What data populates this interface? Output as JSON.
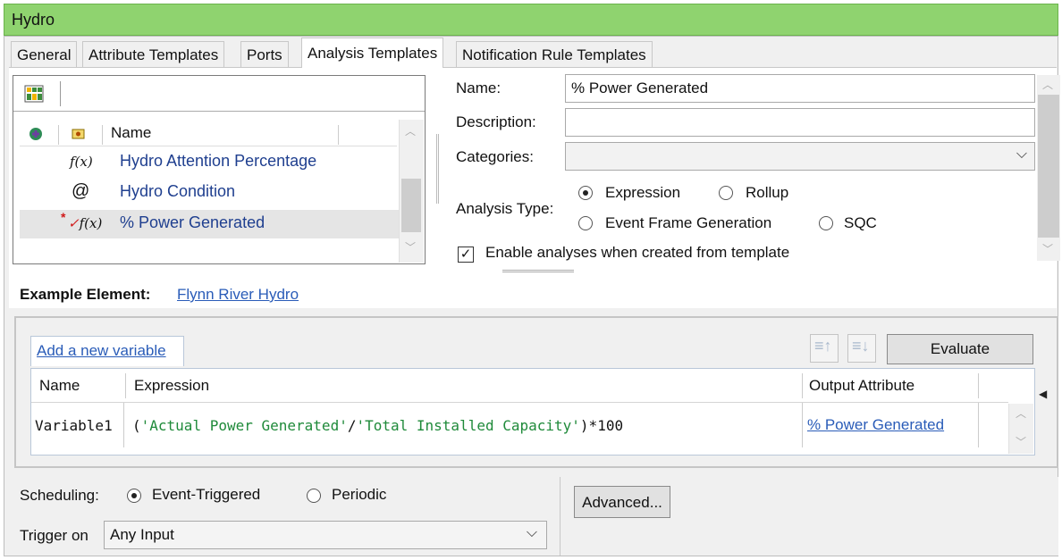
{
  "window": {
    "title": "Hydro"
  },
  "tabs": [
    {
      "label": "General"
    },
    {
      "label": "Attribute Templates"
    },
    {
      "label": "Ports"
    },
    {
      "label": "Analysis Templates"
    },
    {
      "label": "Notification Rule Templates"
    }
  ],
  "list": {
    "header_name": "Name",
    "items": [
      {
        "icon": "f(x)",
        "label": "Hydro Attention Percentage"
      },
      {
        "icon": "@",
        "label": "Hydro Condition"
      },
      {
        "icon": "f(x)",
        "label": "% Power Generated"
      }
    ]
  },
  "form": {
    "name_label": "Name:",
    "name_value": "% Power Generated",
    "description_label": "Description:",
    "description_value": "",
    "categories_label": "Categories:",
    "categories_value": "",
    "analysis_type_label": "Analysis Type:",
    "analysis_type_options": [
      "Expression",
      "Rollup",
      "Event Frame Generation",
      "SQC"
    ],
    "analysis_type_selected": "Expression",
    "enable_label": "Enable analyses when created from template",
    "enable_checked": true
  },
  "example_element": {
    "label": "Example Element:",
    "value": "Flynn River Hydro"
  },
  "variables": {
    "add_link": "Add a new variable",
    "evaluate_label": "Evaluate",
    "columns": [
      "Name",
      "Expression",
      "Output Attribute"
    ],
    "rows": [
      {
        "name": "Variable1",
        "expr_open": "(",
        "expr_str1": "'Actual Power Generated'",
        "expr_op": "/",
        "expr_str2": "'Total Installed Capacity'",
        "expr_close": ")*100",
        "output": "% Power Generated"
      }
    ]
  },
  "scheduling": {
    "label": "Scheduling:",
    "options": [
      "Event-Triggered",
      "Periodic"
    ],
    "selected": "Event-Triggered",
    "trigger_label": "Trigger on",
    "trigger_value": "Any Input",
    "advanced_label": "Advanced..."
  }
}
